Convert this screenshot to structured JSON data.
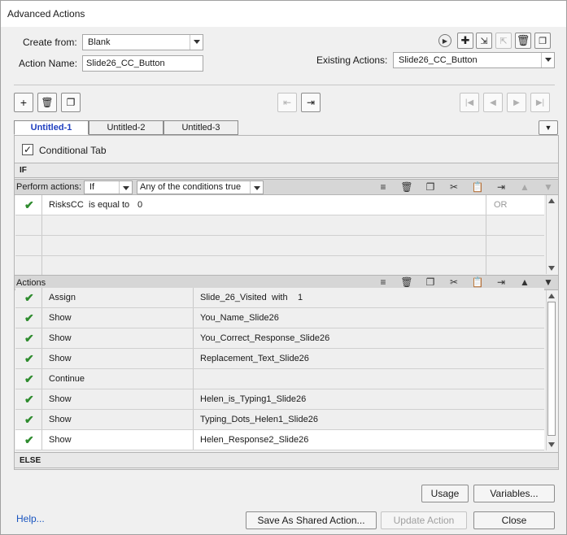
{
  "window": {
    "title": "Advanced Actions"
  },
  "form": {
    "create_from_label": "Create from:",
    "create_from_value": "Blank",
    "action_name_label": "Action Name:",
    "action_name_value": "Slide26_CC_Button",
    "existing_actions_label": "Existing Actions:",
    "existing_actions_value": "Slide26_CC_Button"
  },
  "tabs": [
    {
      "label": "Untitled-1",
      "active": true
    },
    {
      "label": "Untitled-2",
      "active": false
    },
    {
      "label": "Untitled-3",
      "active": false
    }
  ],
  "conditional": {
    "label": "Conditional Tab",
    "checked": true
  },
  "if_section": {
    "label": "IF",
    "perform_label": "Perform actions:",
    "perform_value": "If",
    "condition_mode": "Any of the conditions true",
    "rows": [
      {
        "variable": "RisksCC",
        "operator": "is equal to",
        "value": "0",
        "logic": "OR"
      }
    ]
  },
  "actions_section": {
    "label": "Actions",
    "rows": [
      {
        "action": "Assign",
        "target": "Slide_26_Visited",
        "extra": "with",
        "value": "1"
      },
      {
        "action": "Show",
        "target": "You_Name_Slide26"
      },
      {
        "action": "Show",
        "target": "You_Correct_Response_Slide26"
      },
      {
        "action": "Show",
        "target": "Replacement_Text_Slide26"
      },
      {
        "action": "Continue",
        "target": ""
      },
      {
        "action": "Show",
        "target": "Helen_is_Typing1_Slide26"
      },
      {
        "action": "Show",
        "target": "Typing_Dots_Helen1_Slide26"
      },
      {
        "action": "Show",
        "target": "Helen_Response2_Slide26"
      }
    ]
  },
  "else_section": {
    "label": "ELSE"
  },
  "buttons": {
    "usage": "Usage",
    "variables": "Variables...",
    "help": "Help...",
    "save_shared": "Save As Shared Action...",
    "update": "Update Action",
    "close": "Close"
  }
}
